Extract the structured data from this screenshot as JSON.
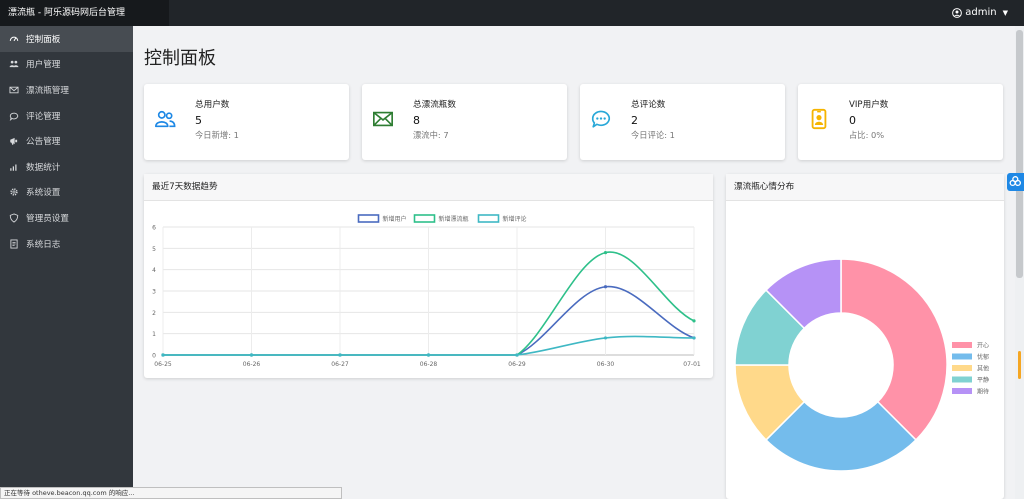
{
  "header": {
    "brand": "漂流瓶 - 阿乐源码网后台管理",
    "user": "admin"
  },
  "sidebar": {
    "items": [
      {
        "label": "控制面板",
        "icon": "gauge-icon"
      },
      {
        "label": "用户管理",
        "icon": "users-icon"
      },
      {
        "label": "漂流瓶管理",
        "icon": "envelope-icon"
      },
      {
        "label": "评论管理",
        "icon": "comment-icon"
      },
      {
        "label": "公告管理",
        "icon": "megaphone-icon"
      },
      {
        "label": "数据统计",
        "icon": "bar-chart-icon"
      },
      {
        "label": "系统设置",
        "icon": "gear-icon"
      },
      {
        "label": "管理员设置",
        "icon": "shield-icon"
      },
      {
        "label": "系统日志",
        "icon": "document-icon"
      }
    ]
  },
  "main": {
    "title": "控制面板",
    "stats": [
      {
        "label": "总用户数",
        "value": "5",
        "sub": "今日新增: 1",
        "icon": "users-icon",
        "color": "#1e88e5"
      },
      {
        "label": "总漂流瓶数",
        "value": "8",
        "sub": "漂流中: 7",
        "icon": "envelope-icon",
        "color": "#2e7d32"
      },
      {
        "label": "总评论数",
        "value": "2",
        "sub": "今日评论: 1",
        "icon": "comment-dots-icon",
        "color": "#29a8d8"
      },
      {
        "label": "VIP用户数",
        "value": "0",
        "sub": "占比: 0%",
        "icon": "id-badge-icon",
        "color": "#f5b400"
      }
    ]
  },
  "trend": {
    "title": "最近7天数据趋势"
  },
  "mood": {
    "title": "漂流瓶心情分布"
  },
  "status_text": "正在等待 otheve.beacon.qq.com 的响应...",
  "chart_data": [
    {
      "type": "line",
      "categories": [
        "06-25",
        "06-26",
        "06-27",
        "06-28",
        "06-29",
        "06-30",
        "07-01"
      ],
      "yticks": [
        "0",
        "1",
        "2",
        "3",
        "4",
        "5",
        "6"
      ],
      "ylim": [
        0,
        6
      ],
      "grid": true,
      "legend": "top-center",
      "series": [
        {
          "name": "新增用户",
          "values": [
            0,
            0,
            0,
            0,
            0,
            3.2,
            0.8
          ],
          "color": "#4a6bbf"
        },
        {
          "name": "新增漂流瓶",
          "values": [
            0,
            0,
            0,
            0,
            0,
            4.8,
            1.6
          ],
          "color": "#2ec08a"
        },
        {
          "name": "新增评论",
          "values": [
            0,
            0,
            0,
            0,
            0,
            0.8,
            0.8
          ],
          "color": "#3fb8c4"
        }
      ]
    },
    {
      "type": "pie",
      "legend": "right",
      "slices": [
        {
          "name": "开心",
          "value": 3,
          "color": "#ff92a8"
        },
        {
          "name": "忧郁",
          "value": 2,
          "color": "#74bcec"
        },
        {
          "name": "其他",
          "value": 1,
          "color": "#ffd98a"
        },
        {
          "name": "平静",
          "value": 1,
          "color": "#80d2d2"
        },
        {
          "name": "期待",
          "value": 1,
          "color": "#b692f6"
        }
      ]
    }
  ]
}
